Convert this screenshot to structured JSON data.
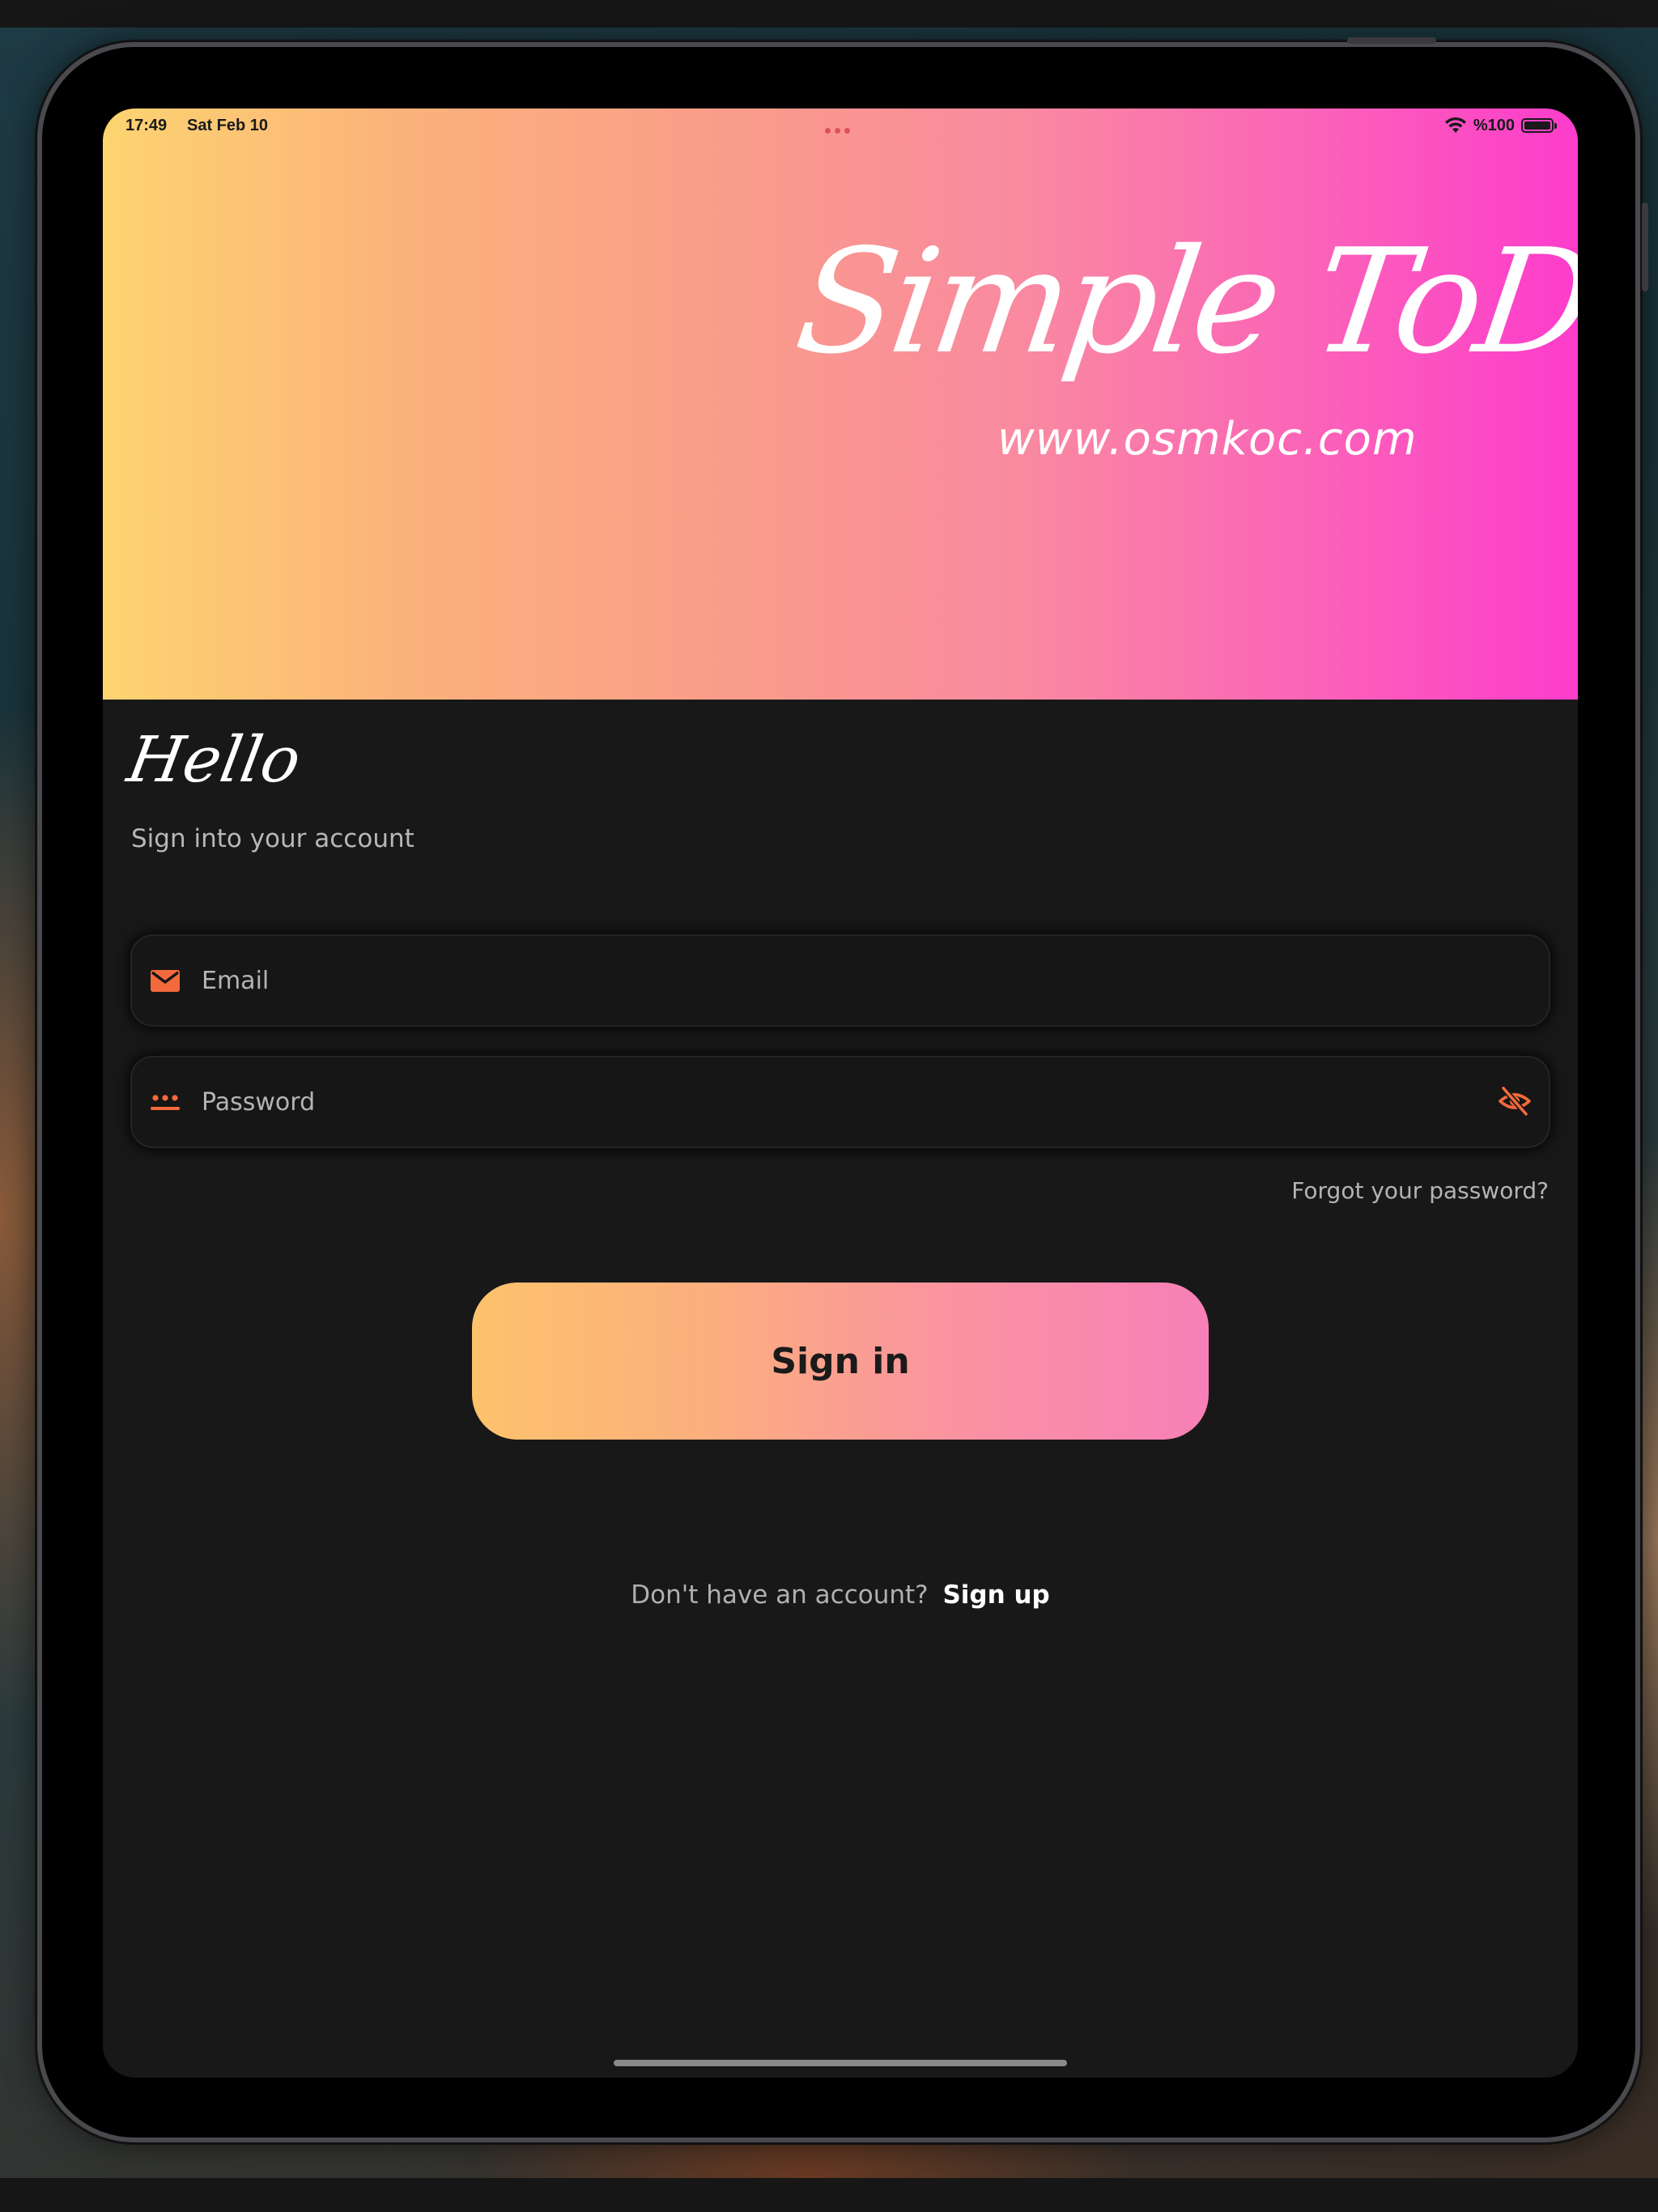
{
  "status_bar": {
    "time": "17:49",
    "date": "Sat Feb 10",
    "battery": "%100"
  },
  "hero": {
    "title": "Simple ToDo",
    "url": "www.osmkoc.com"
  },
  "greeting": {
    "title": "Hello",
    "subtitle": "Sign into your account"
  },
  "form": {
    "email": {
      "placeholder": "Email",
      "value": ""
    },
    "password": {
      "placeholder": "Password",
      "value": ""
    },
    "forgot_label": "Forgot your password?",
    "signin_label": "Sign in"
  },
  "signup": {
    "prompt": "Don't have an account?",
    "link": "Sign up"
  },
  "icons": {
    "email": "mail-icon",
    "password": "password-dots-icon",
    "toggle": "eye-off-icon",
    "wifi": "wifi-icon",
    "battery": "battery-icon"
  },
  "colors": {
    "accent": "#f36a3c",
    "gradient_start": "#fdd470",
    "gradient_end": "#fd3ccc",
    "background": "#181818"
  }
}
